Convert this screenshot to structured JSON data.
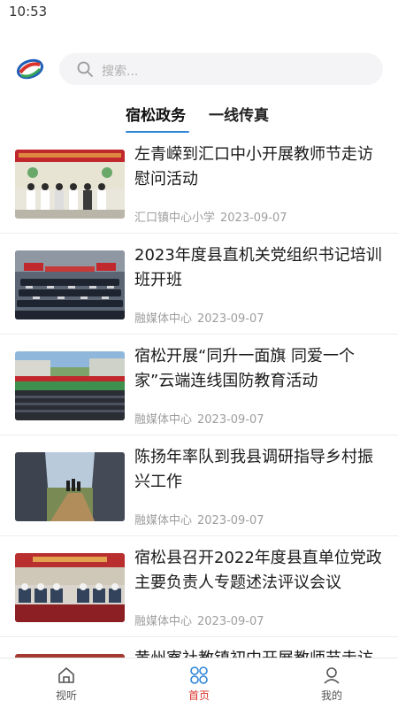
{
  "status_bar": {
    "time": "10:53"
  },
  "search": {
    "placeholder": "搜索..."
  },
  "tabs": [
    {
      "label": "宿松政务",
      "active": true
    },
    {
      "label": "一线传真",
      "active": false
    }
  ],
  "news": [
    {
      "title": "左青嵘到汇口中小开展教师节走访慰问活动",
      "source": "汇口镇中心小学",
      "date": "2023-09-07"
    },
    {
      "title": "2023年度县直机关党组织书记培训班开班",
      "source": "融媒体中心",
      "date": "2023-09-07"
    },
    {
      "title": "宿松开展“同升一面旗 同爱一个家”云端连线国防教育活动",
      "source": "融媒体中心",
      "date": "2023-09-07"
    },
    {
      "title": "陈扬年率队到我县调研指导乡村振兴工作",
      "source": "融媒体中心",
      "date": "2023-09-07"
    },
    {
      "title": "宿松县召开2022年度县直单位党政主要负责人专题述法评议会议",
      "source": "融媒体中心",
      "date": "2023-09-07"
    },
    {
      "title": "黄州寮社教镇初中开展教师节走访",
      "source": "",
      "date": ""
    }
  ],
  "bottom_nav": [
    {
      "label": "视听",
      "icon": "home-icon",
      "active": false
    },
    {
      "label": "首页",
      "icon": "grid-icon",
      "active": true
    },
    {
      "label": "我的",
      "icon": "user-icon",
      "active": false
    }
  ],
  "colors": {
    "accent_blue": "#2f86d6",
    "active_red": "#d8342b",
    "meta_gray": "#9e9e9e"
  }
}
